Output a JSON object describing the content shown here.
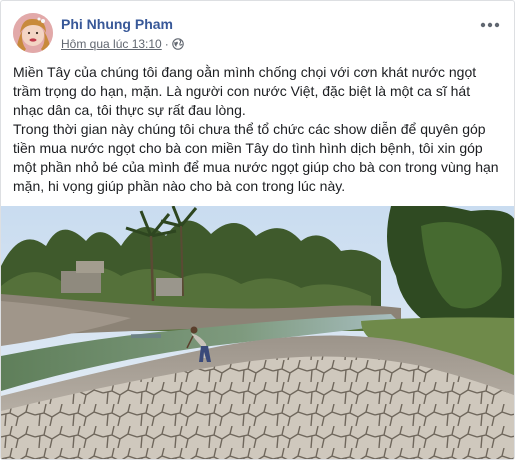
{
  "post": {
    "author": "Phi Nhung Pham",
    "timestamp": "Hôm qua lúc 13:10",
    "separator": "·",
    "privacy_icon": "globe-icon",
    "more_icon": "ellipsis-icon",
    "paragraphs": [
      "Miền Tây của chúng tôi đang oằn mình chống chọi với cơn khát nước ngọt trầm trọng do hạn, mặn. Là người con nước Việt, đặc biệt là một ca sĩ hát nhạc dân ca, tôi thực sự rất đau lòng.",
      "Trong thời gian này chúng tôi chưa thể tổ chức các show diễn để quyên góp tiền mua nước ngọt cho bà con miền Tây do tình hình dịch bệnh, tôi xin góp một phần nhỏ bé của mình để mua nước ngọt giúp cho bà con trong vùng hạn mặn, hi vọng giúp phần nào cho bà con trong lúc này."
    ]
  },
  "colors": {
    "author_link": "#385898",
    "meta_text": "#616770",
    "body_text": "#1c1e21"
  }
}
